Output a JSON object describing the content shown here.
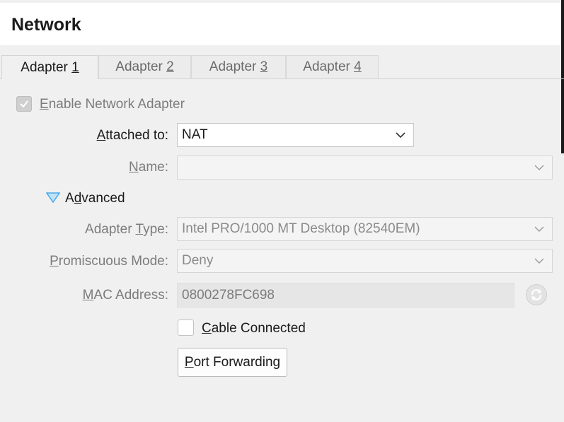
{
  "page": {
    "title": "Network"
  },
  "tabs": [
    {
      "prefix": "Adapter ",
      "key": "1",
      "active": true
    },
    {
      "prefix": "Adapter ",
      "key": "2",
      "active": false
    },
    {
      "prefix": "Adapter ",
      "key": "3",
      "active": false
    },
    {
      "prefix": "Adapter ",
      "key": "4",
      "active": false
    }
  ],
  "form": {
    "enable_adapter": {
      "key": "E",
      "rest": "nable Network Adapter",
      "checked": true,
      "enabled": false
    },
    "attached_to": {
      "label_key": "A",
      "label_rest": "ttached to:",
      "value": "NAT"
    },
    "name": {
      "label_key": "N",
      "label_rest": "ame:",
      "value": ""
    },
    "advanced": {
      "pre": "A",
      "key": "d",
      "rest": "vanced",
      "expanded": true
    },
    "adapter_type": {
      "label_pre": "Adapter ",
      "label_key": "T",
      "label_rest": "ype:",
      "value": "Intel PRO/1000 MT Desktop (82540EM)"
    },
    "promiscuous_mode": {
      "label_key": "P",
      "label_rest": "romiscuous Mode:",
      "value": "Deny"
    },
    "mac_address": {
      "label_key": "M",
      "label_rest": "AC Address:",
      "value": "0800278FC698"
    },
    "cable_connected": {
      "key": "C",
      "rest": "able Connected",
      "checked": false
    },
    "port_forwarding": {
      "key": "P",
      "rest": "ort Forwarding"
    }
  },
  "icons": {
    "checkmark": "checkmark-icon",
    "chevron": "chevron-down-icon",
    "expander": "triangle-down-icon",
    "refresh": "refresh-icon"
  },
  "colors": {
    "accent": "#4aa8e8",
    "header_bg": "#ffffff",
    "panel_bg": "#f0f0f0"
  }
}
